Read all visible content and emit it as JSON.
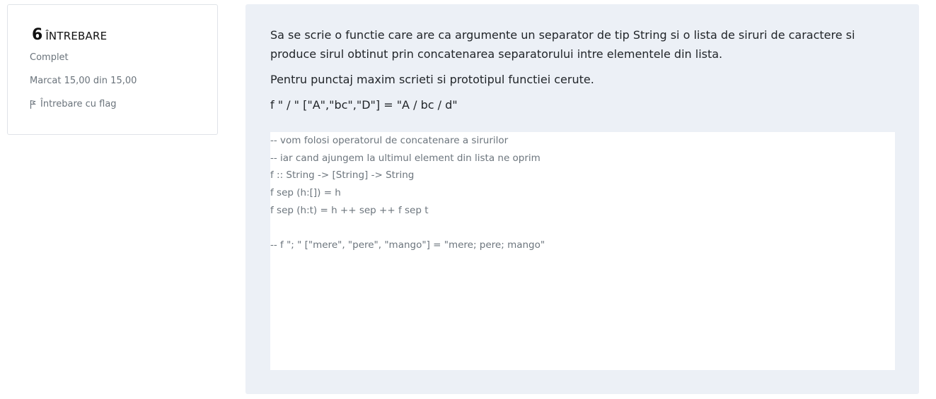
{
  "info": {
    "question_number": "6",
    "question_label": "ÎNTREBARE",
    "state": "Complet",
    "grade": "Marcat 15,00 din 15,00",
    "flag_label": "Întrebare cu flag",
    "flag_icon": "flag-icon"
  },
  "question": {
    "paragraphs": [
      "Sa se scrie o functie care are ca argumente un separator de tip String si o lista de siruri de caractere si produce sirul obtinut prin concatenarea separatorului intre elementele din lista.",
      "Pentru punctaj maxim scrieti si prototipul functiei cerute.",
      "f \" / \" [\"A\",\"bc\",\"D\"] = \"A / bc / d\""
    ]
  },
  "answer": {
    "lines": [
      "-- vom folosi operatorul de concatenare a sirurilor",
      "-- iar cand ajungem la ultimul element din lista ne oprim",
      "f :: String -> [String] -> String",
      "f sep (h:[]) = h",
      "f sep (h:t) = h ++ sep ++ f sep t",
      "",
      "-- f \"; \" [\"mere\", \"pere\", \"mango\"] = \"mere; pere; mango\""
    ]
  },
  "colors": {
    "panel_background": "#ecf0f6",
    "muted_text": "#6a737b",
    "answer_text": "#6c757d"
  }
}
